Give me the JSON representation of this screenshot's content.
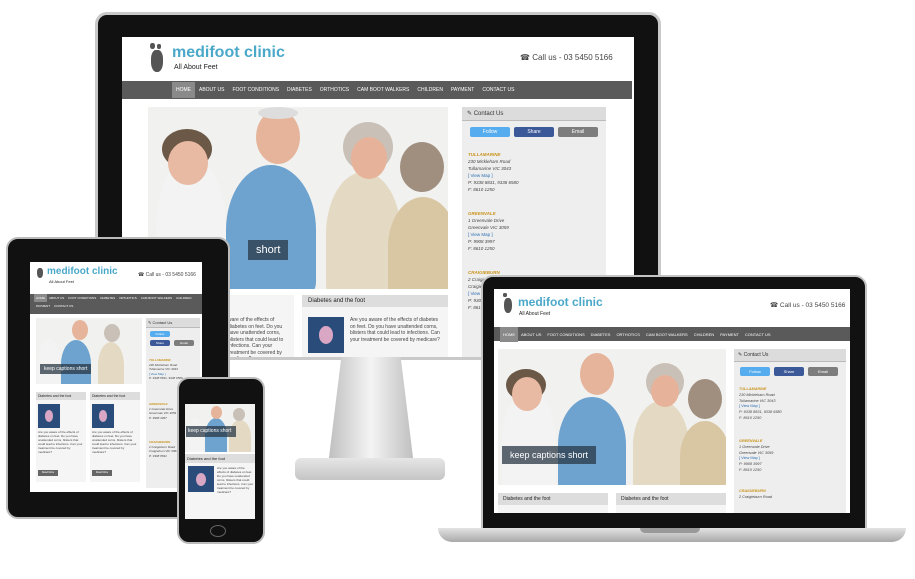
{
  "site": {
    "logo_name": "medifoot clinic",
    "logo_tagline": "All About Feet",
    "phone_icon": "phone-icon",
    "phone": "Call us - 03 5450 5166",
    "phone_small": "Call us - 03 5450 5166"
  },
  "nav": {
    "items": [
      "HOME",
      "ABOUT US",
      "FOOT CONDITIONS",
      "DIABETES",
      "ORTHOTICS",
      "CAM BOOT WALKERS",
      "CHILDREN",
      "PAYMENT",
      "CONTACT US"
    ]
  },
  "hero": {
    "caption": "keep captions short",
    "caption_partial": "short",
    "caption_phone": "keep captions short"
  },
  "sidebar": {
    "title": "Contact Us",
    "icon": "pencil-icon",
    "follow": "Follow",
    "share": "Share",
    "email": "Email",
    "locations": [
      {
        "name": "TULLAMARINE",
        "line1": "230 Mickleham Road",
        "line2": "Tullamarine VIC 3043",
        "map": "[ View Map ]",
        "phone": "P: 9338 8831, 9338 6580",
        "fax": "F: 8610 1250"
      },
      {
        "name": "GREENVALE",
        "line1": "1 Greenvale Drive",
        "line2": "Greenvale VIC 3059",
        "map": "[ View Map ]",
        "phone": "P: 9908 3997",
        "fax": "F: 8610 1250"
      },
      {
        "name": "CRAIGIEBURN",
        "line1": "2 Craigieburn Road",
        "line2": "Craigieburn VIC 3064",
        "map": "[ View Map ]",
        "phone": "P: 9308 8831",
        "fax": "F: 8610 1250"
      }
    ]
  },
  "boxes": {
    "title": "Diabetes and the foot",
    "text": "Are you aware of the effects of diabetes on feet. Do you have unattended corns, blisters that could lead to infections. Can your treatment be covered by medicare?",
    "text_left_partial": "ware of the effects of diabetes on feet. Do you have unattended corns, blisters that could lead to infections. Can your treatment be covered by medicare?",
    "more": "Read More"
  },
  "colors": {
    "brand": "#4aa8c9",
    "nav": "#5a5a5a",
    "follow": "#55acee",
    "share": "#3b5998",
    "email": "#7d7d7d",
    "location": "#c9931a"
  }
}
